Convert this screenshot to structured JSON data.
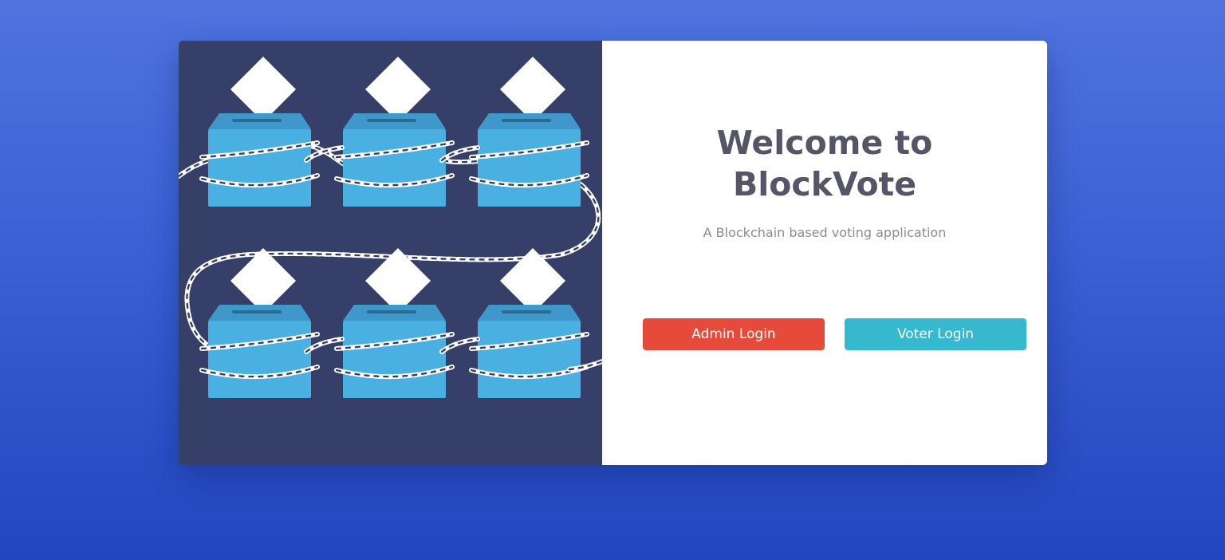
{
  "welcome": {
    "title_line1": "Welcome to",
    "title_line2": "BlockVote",
    "subtitle": "A Blockchain based voting application"
  },
  "actions": {
    "admin_label": "Admin Login",
    "voter_label": "Voter Login"
  },
  "colors": {
    "background_gradient_top": "#4f74e0",
    "background_gradient_bottom": "#2246be",
    "illustration_bg": "#353f67",
    "ballot_box": "#4ab0e1",
    "admin_button": "#e64a3a",
    "voter_button": "#36b8ce",
    "title_text": "#545567"
  },
  "illustration": {
    "icon": "chained-ballot-boxes-icon",
    "ballot_box_count": 6
  }
}
